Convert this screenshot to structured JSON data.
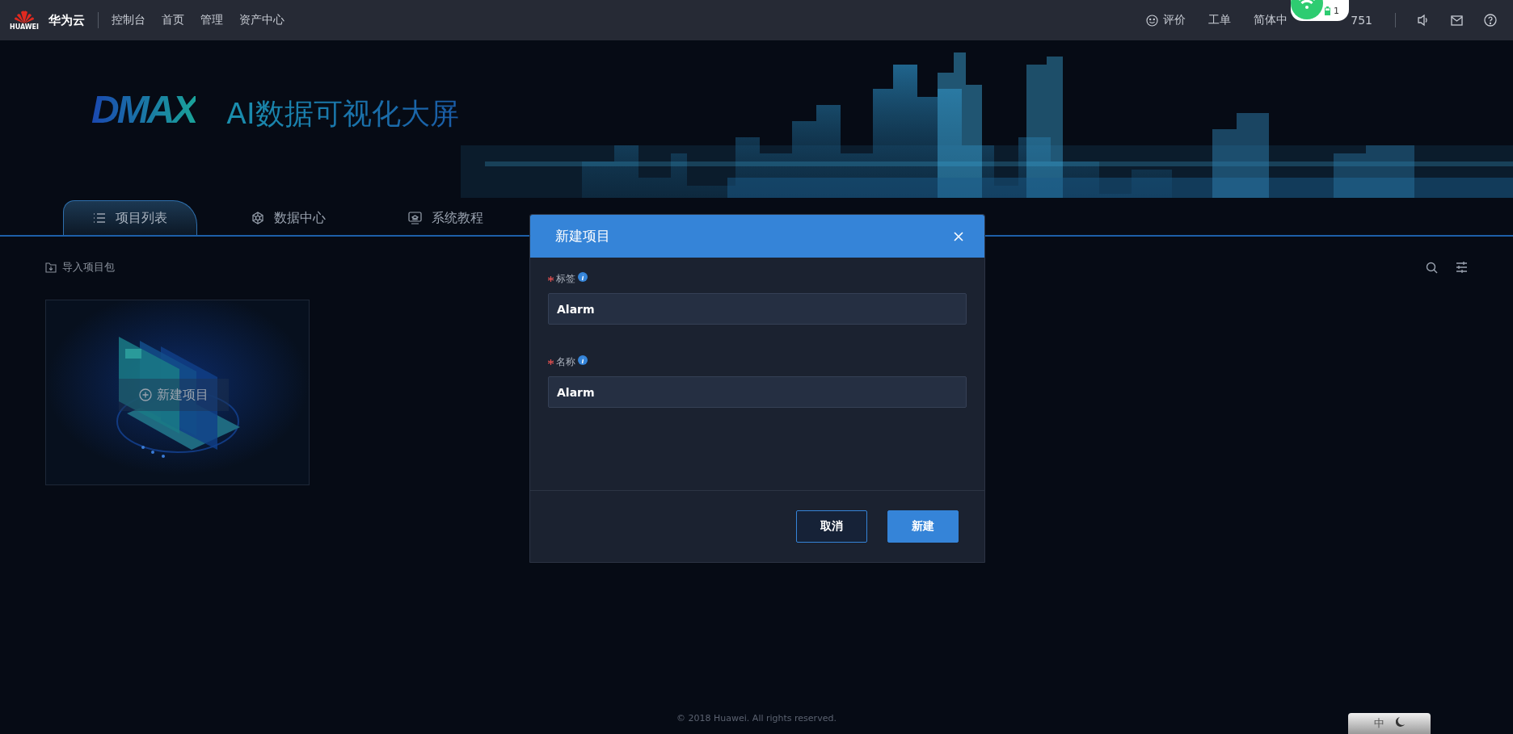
{
  "topbar": {
    "logo_text": "HUAWEI",
    "brand": "华为云",
    "nav": [
      "控制台",
      "首页",
      "管理",
      "资产中心"
    ],
    "right": [
      {
        "kind": "feedback",
        "label": "评价"
      },
      {
        "kind": "text",
        "label": "工单"
      },
      {
        "kind": "text",
        "label": "简体中"
      },
      {
        "kind": "text",
        "label": "751"
      }
    ]
  },
  "popup": {
    "battery_count": "1"
  },
  "banner": {
    "logo": "DMAX",
    "title": "AI数据可视化大屏"
  },
  "tabs": [
    {
      "kind": "list",
      "label": "项目列表",
      "selected": true
    },
    {
      "kind": "network",
      "label": "数据中心",
      "selected": false
    },
    {
      "kind": "tutorial",
      "label": "系统教程",
      "selected": false
    }
  ],
  "toolbar": {
    "import": "导入项目包"
  },
  "project_card": {
    "label": "新建项目"
  },
  "dialog": {
    "title": "新建项目",
    "fields": [
      {
        "label": "标签",
        "required": true,
        "value": "Alarm"
      },
      {
        "label": "名称",
        "required": true,
        "value": "Alarm"
      }
    ],
    "buttons": [
      {
        "kind": "secondary",
        "label": "取消"
      },
      {
        "kind": "primary",
        "label": "新建"
      }
    ]
  },
  "footer": "© 2018 Huawei. All rights reserved.",
  "widget": {
    "label": "中"
  }
}
